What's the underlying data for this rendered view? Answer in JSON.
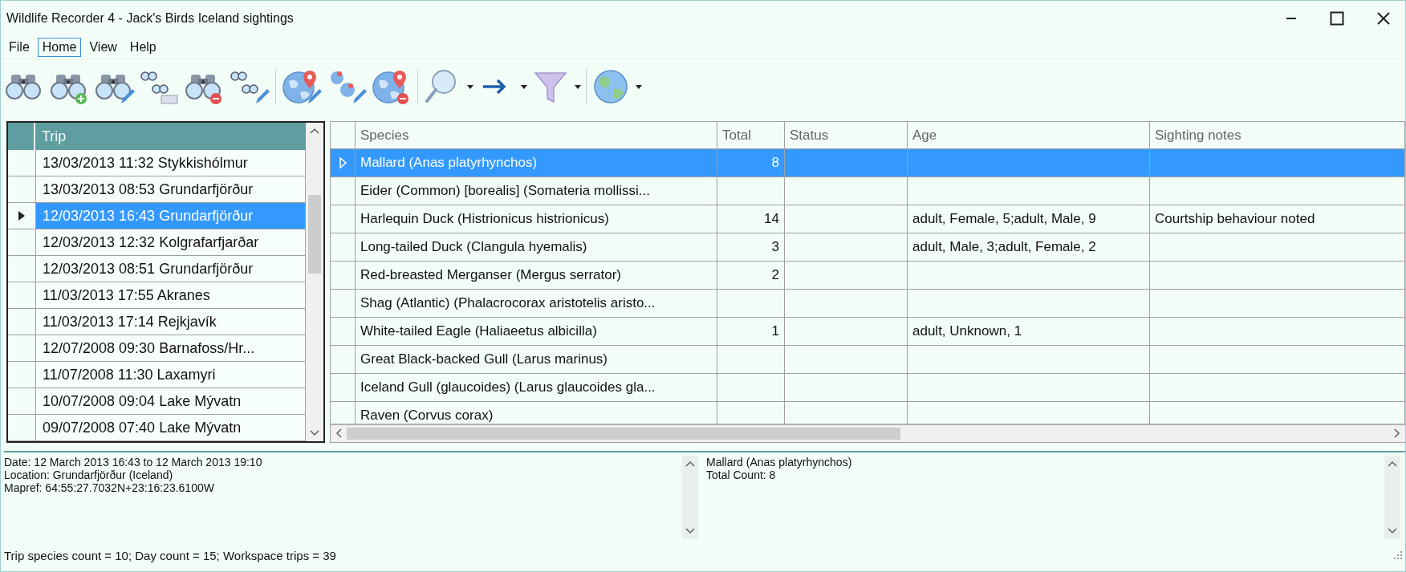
{
  "window": {
    "title": "Wildlife Recorder 4 - Jack's Birds Iceland sightings"
  },
  "menu": [
    {
      "label": "File",
      "selected": false
    },
    {
      "label": "Home",
      "selected": true
    },
    {
      "label": "View",
      "selected": false
    },
    {
      "label": "Help",
      "selected": false
    }
  ],
  "trips": {
    "columns": [
      "Trip"
    ],
    "rows": [
      {
        "text": "13/03/2013 11:32 Stykkishólmur",
        "selected": false
      },
      {
        "text": "13/03/2013 08:53 Grundarfjörður",
        "selected": false
      },
      {
        "text": "12/03/2013 16:43 Grundarfjörður",
        "selected": true
      },
      {
        "text": "12/03/2013 12:32 Kolgrafarfjarðar",
        "selected": false
      },
      {
        "text": "12/03/2013 08:51 Grundarfjörður",
        "selected": false
      },
      {
        "text": "11/03/2013 17:55 Akranes",
        "selected": false
      },
      {
        "text": "11/03/2013 17:14 Rejkjavík",
        "selected": false
      },
      {
        "text": "12/07/2008 09:30 Barnafoss/Hr...",
        "selected": false
      },
      {
        "text": "11/07/2008 11:30 Laxamyri",
        "selected": false
      },
      {
        "text": "10/07/2008 09:04 Lake Mývatn",
        "selected": false
      },
      {
        "text": "09/07/2008 07:40 Lake Mývatn",
        "selected": false
      }
    ]
  },
  "sightings": {
    "columns": [
      "Species",
      "Total",
      "Status",
      "Age",
      "Sighting notes"
    ],
    "rows": [
      {
        "species": "Mallard (Anas platyrhynchos)",
        "total": "8",
        "selected": true
      },
      {
        "species": "Eider (Common) [borealis] (Somateria mollissi...",
        "selected": false
      },
      {
        "species": "Harlequin Duck (Histrionicus histrionicus)",
        "total": "14",
        "age": "adult, Female, 5;adult, Male, 9",
        "notes": "Courtship behaviour noted",
        "selected": false
      },
      {
        "species": "Long-tailed Duck (Clangula hyemalis)",
        "total": "3",
        "age": "adult, Male, 3;adult, Female, 2",
        "selected": false
      },
      {
        "species": "Red-breasted Merganser (Mergus serrator)",
        "total": "2",
        "selected": false
      },
      {
        "species": "Shag (Atlantic) (Phalacrocorax aristotelis aristo...",
        "selected": false
      },
      {
        "species": "White-tailed Eagle (Haliaeetus albicilla)",
        "total": "1",
        "age": "adult, Unknown, 1",
        "selected": false
      },
      {
        "species": "Great Black-backed Gull (Larus marinus)",
        "selected": false
      },
      {
        "species": "Iceland Gull (glaucoides) (Larus glaucoides gla...",
        "selected": false
      },
      {
        "species": "Raven (Corvus corax)",
        "selected": false
      }
    ]
  },
  "trip_details": [
    "Date: 12 March 2013 16:43 to 12 March 2013 19:10",
    "Location: Grundarfjörður (Iceland)",
    "Mapref: 64:55:27.7032N+23:16:23.6100W"
  ],
  "sighting_details": [
    "Mallard (Anas platyrhynchos)",
    "Total Count: 8"
  ],
  "status_bar": "Trip species count = 10; Day count = 15;  Workspace trips = 39"
}
